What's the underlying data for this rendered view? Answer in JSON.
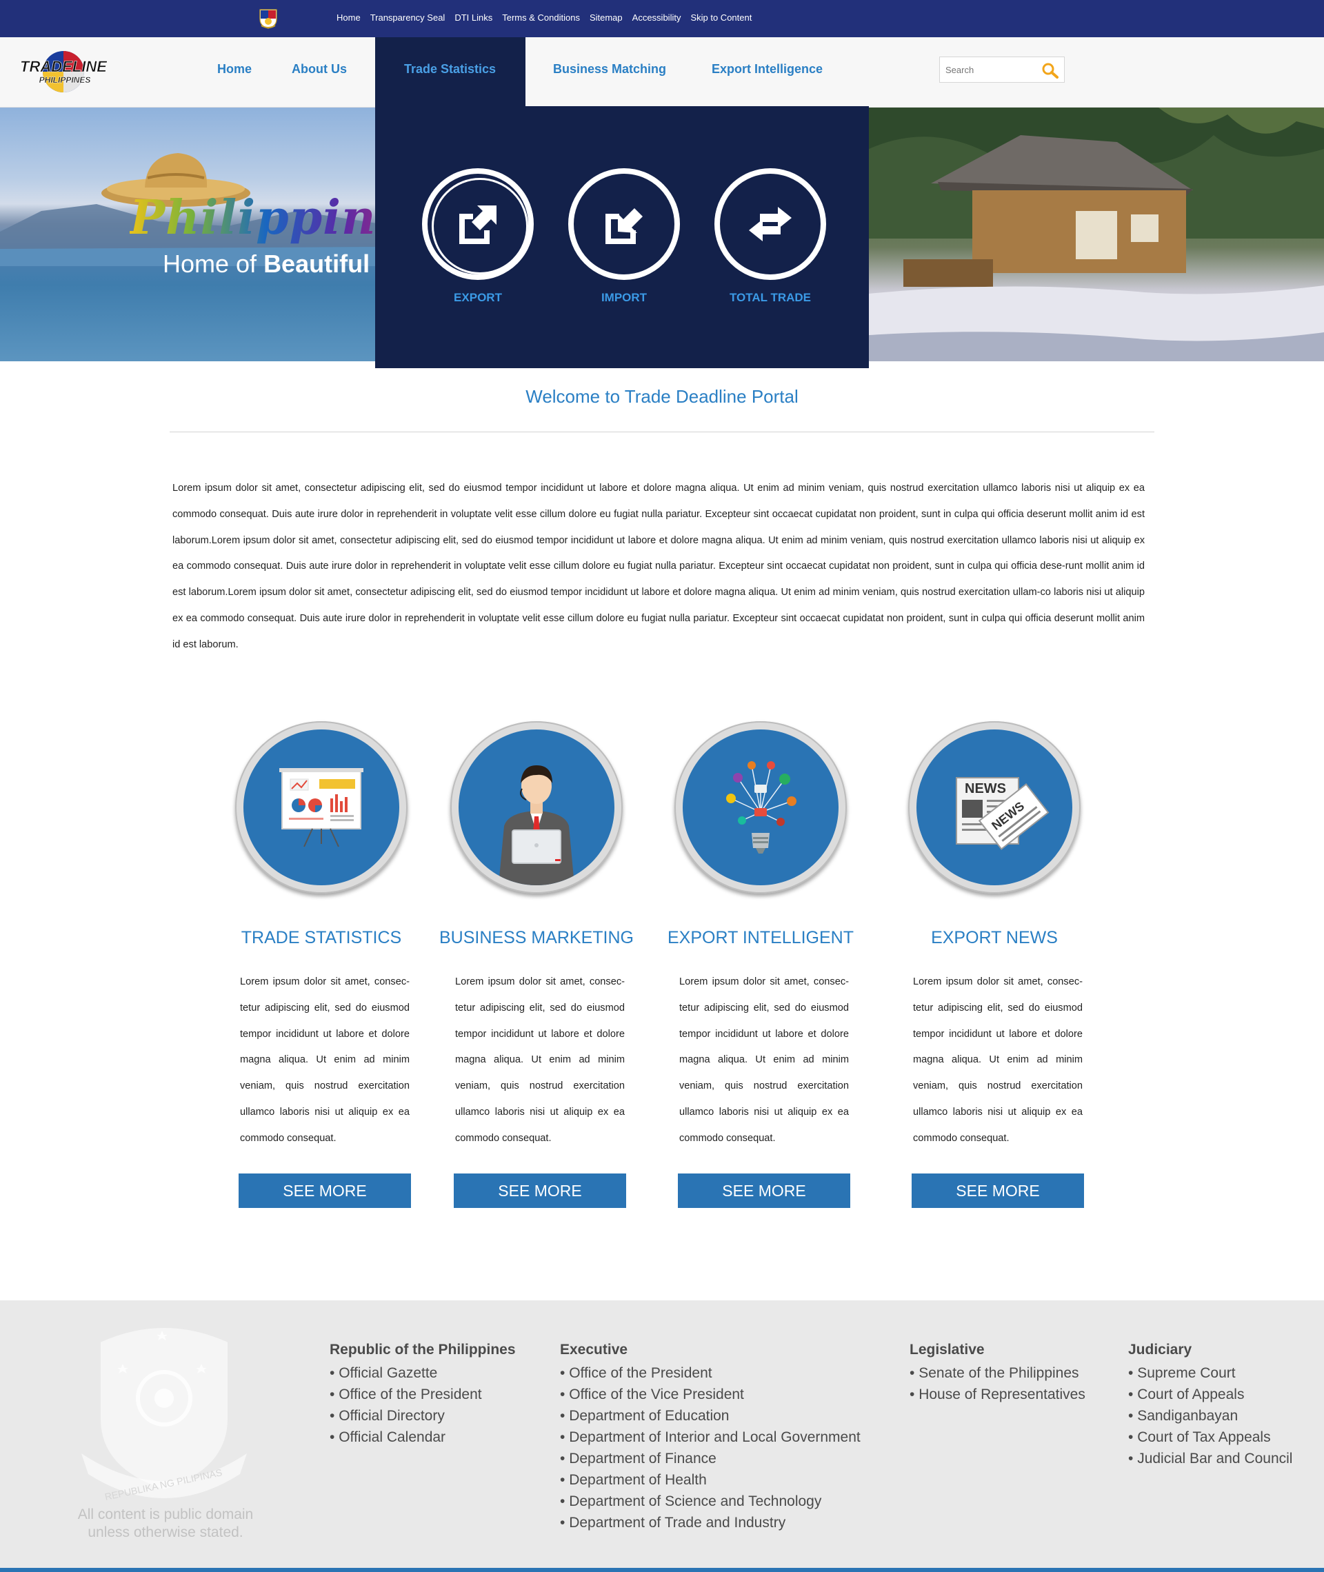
{
  "gov_bar": {
    "links": [
      "Home",
      "Transparency Seal",
      "DTI Links",
      "Terms & Conditions",
      "Sitemap",
      "Accessibility",
      "Skip to Content"
    ]
  },
  "logo": {
    "text_top": "TRADELINE",
    "text_bottom": "PHILIPPINES"
  },
  "nav": {
    "home": "Home",
    "about": "About Us",
    "trade_statistics": "Trade Statistics",
    "business_matching": "Business Matching",
    "export_intelligence": "Export Intelligence"
  },
  "search": {
    "placeholder": "Search"
  },
  "hero": {
    "title": "Philippines",
    "subtitle_plain": "Home of ",
    "subtitle_bold": "Beautiful Beaches"
  },
  "dropdown": {
    "items": [
      {
        "label": "EXPORT",
        "icon": "export-icon"
      },
      {
        "label": "IMPORT",
        "icon": "import-icon"
      },
      {
        "label": "TOTAL TRADE",
        "icon": "swap-arrows-icon"
      }
    ]
  },
  "welcome": {
    "title": "Welcome to Trade Deadline Portal",
    "body": "Lorem ipsum dolor sit amet, consectetur adipiscing elit, sed do eiusmod tempor incididunt ut labore et dolore magna aliqua. Ut enim ad minim veniam, quis nostrud exercitation ullamco laboris nisi ut aliquip ex ea commodo consequat. Duis aute irure dolor in reprehenderit in voluptate velit esse cillum dolore eu fugiat nulla pariatur. Excepteur sint occaecat cupidatat non proident, sunt in culpa qui officia deserunt mollit anim id est laborum.Lorem ipsum dolor sit amet, consectetur adipiscing elit, sed do eiusmod tempor incididunt ut labore et dolore magna aliqua. Ut enim ad minim veniam, quis nostrud exercitation ullamco laboris nisi ut aliquip ex ea commodo consequat. Duis aute irure dolor in reprehenderit in voluptate velit esse cillum dolore eu fugiat nulla pariatur. Excepteur sint occaecat cupidatat non proident, sunt in culpa qui officia dese-runt mollit anim id est laborum.Lorem ipsum dolor sit amet, consectetur adipiscing elit, sed do eiusmod tempor incididunt ut labore et dolore magna aliqua. Ut enim ad minim veniam, quis nostrud exercitation ullam-co laboris nisi ut aliquip ex ea commodo consequat. Duis aute irure dolor in reprehenderit in voluptate velit esse cillum dolore eu fugiat nulla pariatur. Excepteur sint occaecat cupidatat non proident, sunt in culpa qui officia deserunt mollit anim id est laborum."
  },
  "cards": [
    {
      "title": "TRADE STATISTICS",
      "icon": "presentation-board-icon",
      "text": "Lorem ipsum dolor sit amet, consec-tetur adipiscing elit, sed do eiusmod tempor incididunt ut labore et dolore magna aliqua. Ut enim ad minim veniam, quis nostrud exercitation ullamco laboris nisi ut aliquip ex ea commodo consequat.",
      "button": "SEE MORE"
    },
    {
      "title": "BUSINESS MARKETING",
      "icon": "businessman-laptop-icon",
      "text": "Lorem ipsum dolor sit amet, consec-tetur adipiscing elit, sed do eiusmod tempor incididunt ut labore et dolore magna aliqua. Ut enim ad minim veniam, quis nostrud exercitation ullamco laboris nisi ut aliquip ex ea commodo consequat.",
      "button": "SEE MORE"
    },
    {
      "title": "EXPORT INTELLIGENT",
      "icon": "lightbulb-network-icon",
      "text": "Lorem ipsum dolor sit amet, consec-tetur adipiscing elit, sed do eiusmod tempor incididunt ut labore et dolore magna aliqua. Ut enim ad minim veniam, quis nostrud exercitation ullamco laboris nisi ut aliquip ex ea commodo consequat.",
      "button": "SEE MORE"
    },
    {
      "title": "EXPORT NEWS",
      "icon": "newspaper-icon",
      "text": "Lorem ipsum dolor sit amet, consec-tetur adipiscing elit, sed do eiusmod tempor incididunt ut labore et dolore magna aliqua. Ut enim ad minim veniam, quis nostrud exercitation ullamco laboris nisi ut aliquip ex ea commodo consequat.",
      "button": "SEE MORE"
    }
  ],
  "news_icon_text": "NEWS",
  "footer": {
    "seal_text": "REPUBLIKA NG PILIPINAS",
    "public_note": "All content is public domain unless otherwise stated.",
    "columns": [
      {
        "heading": "Republic of the Philippines",
        "items": [
          "Official Gazette",
          "Office of the President",
          "Official Directory",
          "Official Calendar"
        ]
      },
      {
        "heading": "Executive",
        "items": [
          "Office of the President",
          "Office of the Vice President",
          "Department of Education",
          "Department of Interior and Local Government",
          "Department of Finance",
          "Department of Health",
          "Department of Science and Technology",
          "Department of Trade and Industry"
        ]
      },
      {
        "heading": "Legislative",
        "items": [
          "Senate of the Philippines",
          "House of Representatives"
        ]
      },
      {
        "heading": "Judiciary",
        "items": [
          "Supreme Court",
          "Court of Appeals",
          "Sandiganbayan",
          "Court of Tax Appeals",
          "Judicial Bar and Council"
        ]
      }
    ]
  },
  "colors": {
    "gov_bar": "#22307a",
    "accent_blue": "#2a7fc4",
    "dropdown_bg": "#13214a",
    "button_blue": "#2a74b4",
    "footer_bg": "#e9e9e9"
  }
}
